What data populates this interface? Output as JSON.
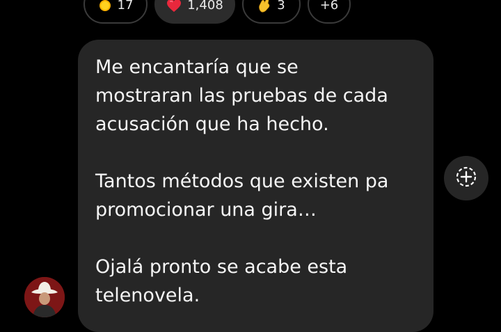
{
  "reactions": [
    {
      "icon": "sun-emoji-icon",
      "count": "17"
    },
    {
      "icon": "red-heart-emoji-icon",
      "count": "1,408",
      "active": true
    },
    {
      "icon": "pinching-hand-emoji-icon",
      "count": "3"
    },
    {
      "label": "+6"
    }
  ],
  "message": {
    "paragraphs": [
      "Me encantaría que se\nmostraran las pruebas de cada\nacusación que ha hecho.",
      "Tantos métodos que existen pa\npromocionar una gira…",
      "Ojalá pronto se acabe esta\ntelenovela."
    ]
  },
  "colors": {
    "background": "#000000",
    "bubble": "#262626",
    "chip_border": "#3a3a3a",
    "text": "#f5f5f5",
    "heart": "#e8283c",
    "sun": "#ffd21f"
  },
  "icons": {
    "add_reaction": "add-reaction-icon",
    "avatar": "user-avatar"
  }
}
